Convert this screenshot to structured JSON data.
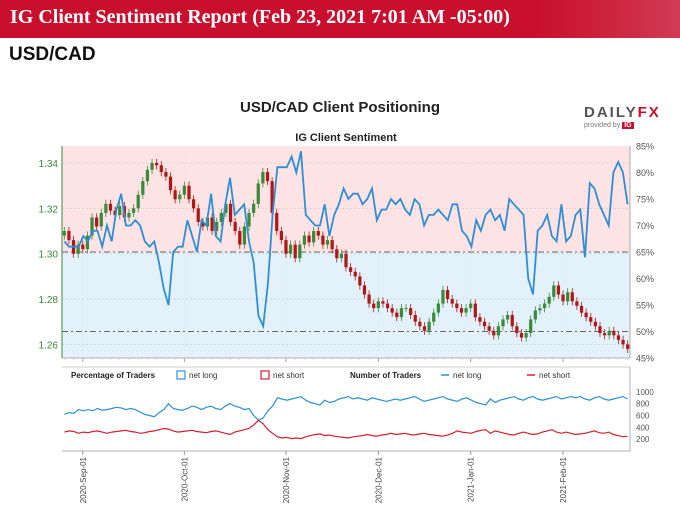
{
  "header": {
    "title": "IG Client Sentiment Report (Feb 23, 2021 7:01 AM -05:00)",
    "pair": "USD/CAD"
  },
  "brand": {
    "logo_left": "DAILY",
    "logo_right": "FX",
    "provided_by": "provided by",
    "ig": "IG"
  },
  "colors": {
    "banner": "#c8102e",
    "net_long": "#2d8fd5",
    "net_short": "#d0202e",
    "candle_up": "#3a8a3a",
    "candle_down": "#b01818",
    "short_zone": "#fde3e3",
    "long_zone": "#e3f1fb"
  },
  "chart_data": [
    {
      "type": "candlestick",
      "title": "USD/CAD Client Positioning",
      "subtitle": "IG Client Sentiment",
      "y_price_ticks": [
        "1.34",
        "1.32",
        "1.30",
        "1.28",
        "1.26"
      ],
      "y_price_range": [
        1.254,
        1.3475
      ],
      "y_sentiment_ticks": [
        "85%",
        "80%",
        "75%",
        "70%",
        "65%",
        "60%",
        "55%",
        "50%",
        "45%"
      ],
      "y_sentiment_range": [
        45,
        85
      ],
      "reference_lines_pct": [
        65,
        50
      ],
      "x_ticks": [
        "2020-Sep-01",
        "2020-Oct-01",
        "2020-Nov-01",
        "2020-Dec-01",
        "2021-Jan-01",
        "2021-Feb-01"
      ],
      "price_close": [
        1.31,
        1.306,
        1.3,
        1.304,
        1.302,
        1.308,
        1.316,
        1.312,
        1.318,
        1.322,
        1.319,
        1.317,
        1.321,
        1.316,
        1.318,
        1.32,
        1.326,
        1.332,
        1.337,
        1.34,
        1.339,
        1.336,
        1.334,
        1.328,
        1.324,
        1.326,
        1.33,
        1.324,
        1.32,
        1.314,
        1.312,
        1.316,
        1.31,
        1.314,
        1.318,
        1.322,
        1.314,
        1.31,
        1.304,
        1.312,
        1.318,
        1.322,
        1.331,
        1.336,
        1.332,
        1.318,
        1.31,
        1.306,
        1.3,
        1.304,
        1.298,
        1.304,
        1.308,
        1.305,
        1.31,
        1.308,
        1.304,
        1.306,
        1.302,
        1.298,
        1.3,
        1.294,
        1.292,
        1.29,
        1.286,
        1.282,
        1.278,
        1.276,
        1.279,
        1.278,
        1.276,
        1.274,
        1.272,
        1.276,
        1.276,
        1.273,
        1.27,
        1.268,
        1.266,
        1.27,
        1.274,
        1.278,
        1.284,
        1.28,
        1.278,
        1.276,
        1.274,
        1.276,
        1.278,
        1.272,
        1.27,
        1.268,
        1.266,
        1.264,
        1.268,
        1.271,
        1.273,
        1.268,
        1.265,
        1.263,
        1.265,
        1.271,
        1.275,
        1.276,
        1.278,
        1.281,
        1.286,
        1.282,
        1.279,
        1.283,
        1.279,
        1.277,
        1.274,
        1.272,
        1.27,
        1.268,
        1.265,
        1.264,
        1.266,
        1.264,
        1.262,
        1.26,
        1.258
      ],
      "sentiment_long_pct": [
        67,
        66,
        66,
        66,
        68,
        67,
        69,
        69,
        66,
        70,
        67,
        73,
        76,
        70,
        70,
        71,
        70,
        67,
        66,
        67,
        63,
        58,
        55,
        65,
        66,
        66,
        71,
        68,
        65,
        71,
        70,
        76,
        68,
        67,
        74,
        79,
        72,
        73,
        74,
        67,
        63,
        53,
        51,
        59,
        72,
        81,
        81,
        81,
        83,
        80,
        84,
        72,
        71,
        70,
        70,
        74,
        68,
        72,
        74,
        77,
        75,
        76,
        76,
        74,
        75,
        77,
        71,
        73,
        73,
        75,
        74,
        75,
        73,
        72,
        75,
        74,
        70,
        72,
        72,
        73,
        72,
        71,
        74,
        74,
        69,
        68,
        66,
        71,
        69,
        72,
        73,
        71,
        72,
        69,
        75,
        74,
        73,
        72,
        60,
        57,
        69,
        70,
        72,
        68,
        67,
        74,
        67,
        68,
        72,
        73,
        64,
        78,
        77,
        74,
        72,
        70,
        80,
        82,
        80,
        74
      ],
      "traders_pct_net_long_legend": "net long",
      "traders_pct_net_short_legend": "net short",
      "number_of_traders_net_long": [
        620,
        650,
        640,
        700,
        680,
        700,
        680,
        720,
        690,
        700,
        720,
        740,
        730,
        700,
        720,
        700,
        660,
        620,
        600,
        580,
        650,
        700,
        800,
        720,
        700,
        690,
        720,
        760,
        740,
        700,
        740,
        760,
        720,
        700,
        760,
        800,
        760,
        740,
        700,
        720,
        600,
        520,
        560,
        680,
        760,
        900,
        880,
        860,
        880,
        900,
        920,
        860,
        820,
        800,
        780,
        860,
        820,
        840,
        880,
        900,
        920,
        880,
        900,
        880,
        860,
        900,
        880,
        860,
        840,
        860,
        880,
        860,
        880,
        900,
        920,
        880,
        840,
        860,
        880,
        900,
        920,
        880,
        860,
        840,
        880,
        900,
        860,
        820,
        800,
        780,
        880,
        820,
        860,
        880,
        900,
        920,
        880,
        860,
        900,
        920,
        880,
        860,
        880,
        900,
        920,
        880,
        900,
        920,
        900,
        920,
        880,
        860,
        900,
        920,
        880,
        860,
        880,
        900,
        920,
        880
      ],
      "number_of_traders_net_short": [
        320,
        340,
        330,
        300,
        320,
        310,
        330,
        340,
        320,
        300,
        320,
        330,
        340,
        350,
        330,
        320,
        300,
        310,
        330,
        340,
        360,
        380,
        370,
        340,
        320,
        330,
        340,
        350,
        330,
        320,
        310,
        330,
        340,
        320,
        300,
        280,
        320,
        340,
        360,
        380,
        440,
        520,
        460,
        360,
        300,
        240,
        220,
        230,
        210,
        220,
        210,
        240,
        260,
        280,
        290,
        260,
        270,
        250,
        240,
        230,
        220,
        240,
        250,
        260,
        280,
        260,
        250,
        270,
        280,
        300,
        280,
        290,
        300,
        280,
        270,
        290,
        300,
        280,
        270,
        260,
        250,
        270,
        300,
        340,
        320,
        310,
        300,
        330,
        350,
        360,
        300,
        340,
        320,
        300,
        280,
        270,
        300,
        320,
        300,
        280,
        290,
        320,
        340,
        360,
        320,
        300,
        320,
        300,
        280,
        290,
        300,
        320,
        340,
        310,
        300,
        320,
        280,
        260,
        240,
        250
      ],
      "lower_legend": {
        "pct_title": "Percentage of Traders",
        "num_title": "Number of Traders",
        "net_long": "net long",
        "net_short": "net short"
      },
      "lower_y_ticks": [
        "1000",
        "800",
        "600",
        "400",
        "200"
      ],
      "lower_y_range": [
        0,
        1100
      ]
    }
  ]
}
